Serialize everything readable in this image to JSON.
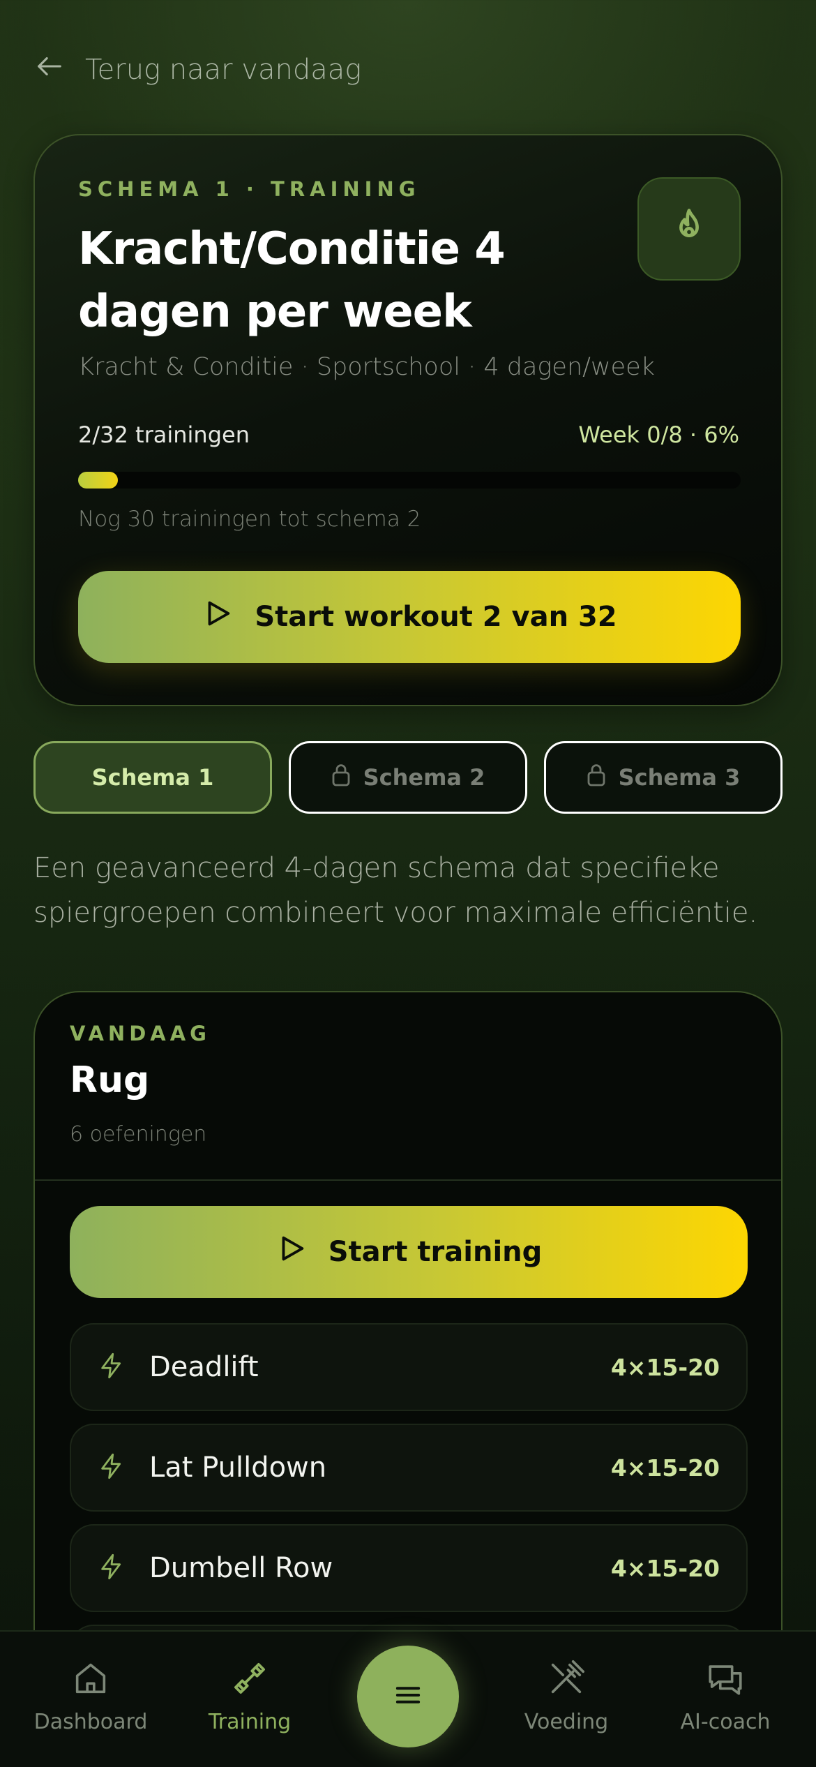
{
  "back": {
    "label": "Terug naar vandaag"
  },
  "hero": {
    "eyebrow": "SCHEMA 1 · TRAINING",
    "title": "Kracht/Conditie 4 dagen per week",
    "subtitle": "Kracht & Conditie · Sportschool · 4 dagen/week",
    "progress_count": "2/32 trainingen",
    "progress_week": "Week 0/8 · 6%",
    "progress_fraction": 0.06,
    "progress_note": "Nog 30 trainingen tot schema 2",
    "start_label": "Start workout 2 van 32"
  },
  "tabs": [
    {
      "label": "Schema 1",
      "state": "active"
    },
    {
      "label": "Schema 2",
      "state": "locked"
    },
    {
      "label": "Schema 3",
      "state": "locked"
    }
  ],
  "description": "Een geavanceerd 4-dagen schema dat specifieke spiergroepen combineert voor maximale efficiëntie.",
  "today": {
    "eyebrow": "VANDAAG",
    "title": "Rug",
    "count": "6 oefeningen",
    "start_label": "Start training",
    "exercises": [
      {
        "name": "Deadlift",
        "sets": "4×15-20"
      },
      {
        "name": "Lat Pulldown",
        "sets": "4×15-20"
      },
      {
        "name": "Dumbell Row",
        "sets": "4×15-20"
      }
    ]
  },
  "nav": {
    "dashboard": "Dashboard",
    "training": "Training",
    "voeding": "Voeding",
    "ai_coach": "AI-coach"
  },
  "colors": {
    "accent": "#8fb15f",
    "accent_light": "#cde39e",
    "cta_start": "#8eb15c",
    "cta_end": "#fdd602"
  }
}
